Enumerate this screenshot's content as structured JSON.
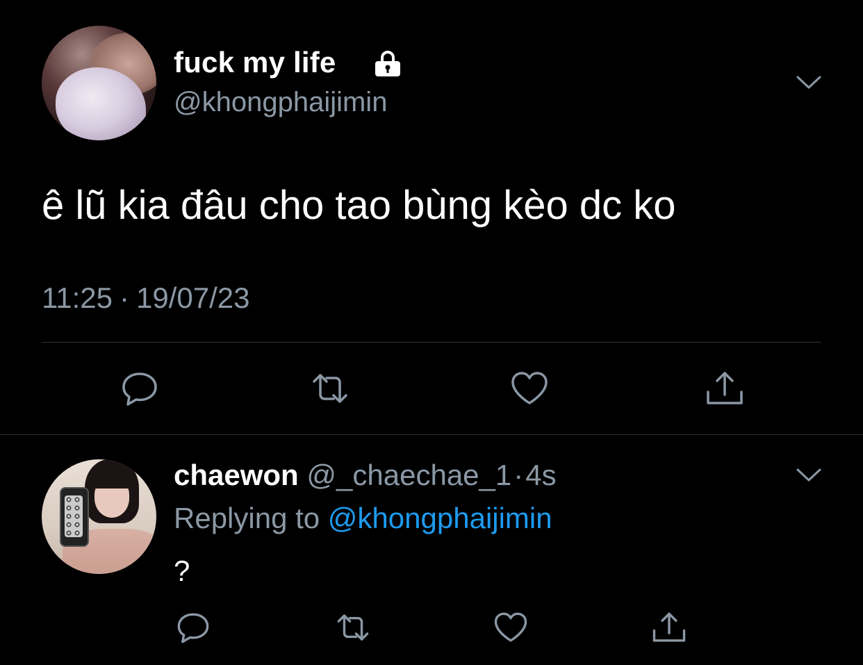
{
  "main_tweet": {
    "display_name": "fuck my life",
    "handle": "@khongphaijimin",
    "protected_icon": "lock-icon",
    "text": "ê lũ kia đâu cho tao bùng kèo dc ko",
    "time": "11:25",
    "separator": "·",
    "date": "19/07/23",
    "actions": [
      "reply-icon",
      "retweet-icon",
      "like-icon",
      "share-icon"
    ]
  },
  "reply_tweet": {
    "display_name": "chaewon",
    "handle": "@_chaechae_1",
    "separator": "·",
    "time": "4s",
    "replying_prefix": "Replying to",
    "replying_mention": "@khongphaijimin",
    "text": "?",
    "actions": [
      "reply-icon",
      "retweet-icon",
      "like-icon",
      "share-icon"
    ]
  },
  "colors": {
    "background": "#000000",
    "primary_text": "#ffffff",
    "secondary_text": "#8b98a5",
    "mention": "#1d9bf0",
    "divider": "#2f3336"
  }
}
